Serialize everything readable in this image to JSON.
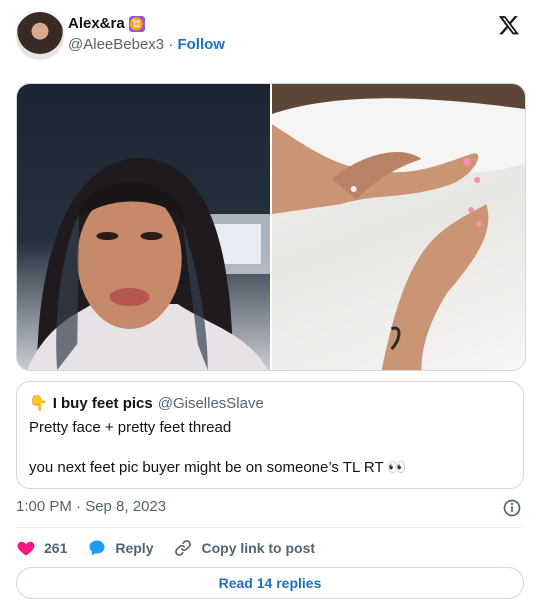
{
  "author": {
    "name": "Alex&ra",
    "zodiac_glyph": "♊",
    "handle": "@AleeBebex3",
    "separator": "·",
    "follow_label": "Follow"
  },
  "quoted_tweet": {
    "emoji": "👇",
    "name": "I buy feet pics",
    "handle": "@GisellesSlave",
    "text": "Pretty face + pretty feet thread\n\nyou next feet pic buyer might be on someone’s TL RT 👀"
  },
  "timestamp": "1:00 PM · Sep 8, 2023",
  "actions": {
    "like_count": "261",
    "reply_label": "Reply",
    "copy_label": "Copy link to post"
  },
  "read_replies_label": "Read 14 replies",
  "colors": {
    "accent": "#1d72c0",
    "like": "#f91880",
    "muted": "#536471",
    "zodiac_bg": "#8e5bd4"
  }
}
